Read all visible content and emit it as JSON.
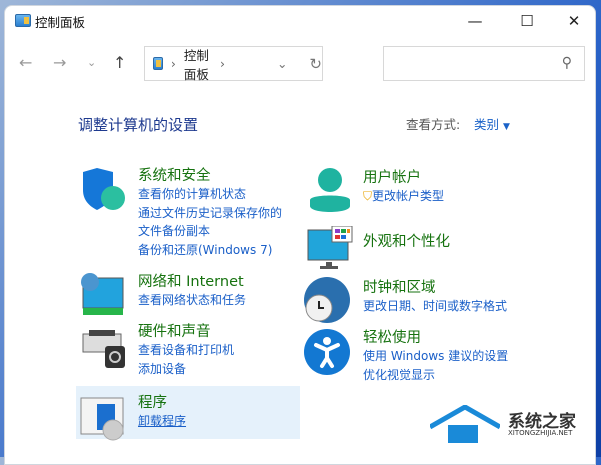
{
  "window": {
    "title": "控制面板",
    "minimize": "—",
    "maximize": "☐",
    "close": "✕"
  },
  "toolbar": {
    "back": "←",
    "forward": "→",
    "recent": "⌄",
    "up": "↑",
    "breadcrumb": "控制面板",
    "sep": "›",
    "dropdown": "⌄",
    "refresh": "↻",
    "search_placeholder": "",
    "search_icon": "⚲"
  },
  "main": {
    "heading": "调整计算机的设置",
    "view_label": "查看方式:",
    "view_value": "类别",
    "view_arrow": "▼"
  },
  "categories": [
    {
      "title": "系统和安全",
      "icon": "shield-icon",
      "links": [
        "查看你的计算机状态",
        "通过文件历史记录保存你的",
        "文件备份副本",
        "备份和还原(Windows 7)"
      ]
    },
    {
      "title": "网络和 Internet",
      "icon": "network-icon",
      "links": [
        "查看网络状态和任务"
      ]
    },
    {
      "title": "硬件和声音",
      "icon": "printer-icon",
      "links": [
        "查看设备和打印机",
        "添加设备"
      ]
    },
    {
      "title": "程序",
      "icon": "programs-icon",
      "links": [
        "卸载程序"
      ]
    },
    {
      "title": "用户帐户",
      "icon": "user-icon",
      "links": [
        "更改帐户类型"
      ]
    },
    {
      "title": "外观和个性化",
      "icon": "monitor-icon",
      "links": []
    },
    {
      "title": "时钟和区域",
      "icon": "clock-globe-icon",
      "links": [
        "更改日期、时间或数字格式"
      ]
    },
    {
      "title": "轻松使用",
      "icon": "accessibility-icon",
      "links": [
        "使用 Windows 建议的设置",
        "优化视觉显示"
      ]
    }
  ],
  "watermark": {
    "name": "系统之家",
    "url": "XITONGZHIJIA.NET"
  }
}
